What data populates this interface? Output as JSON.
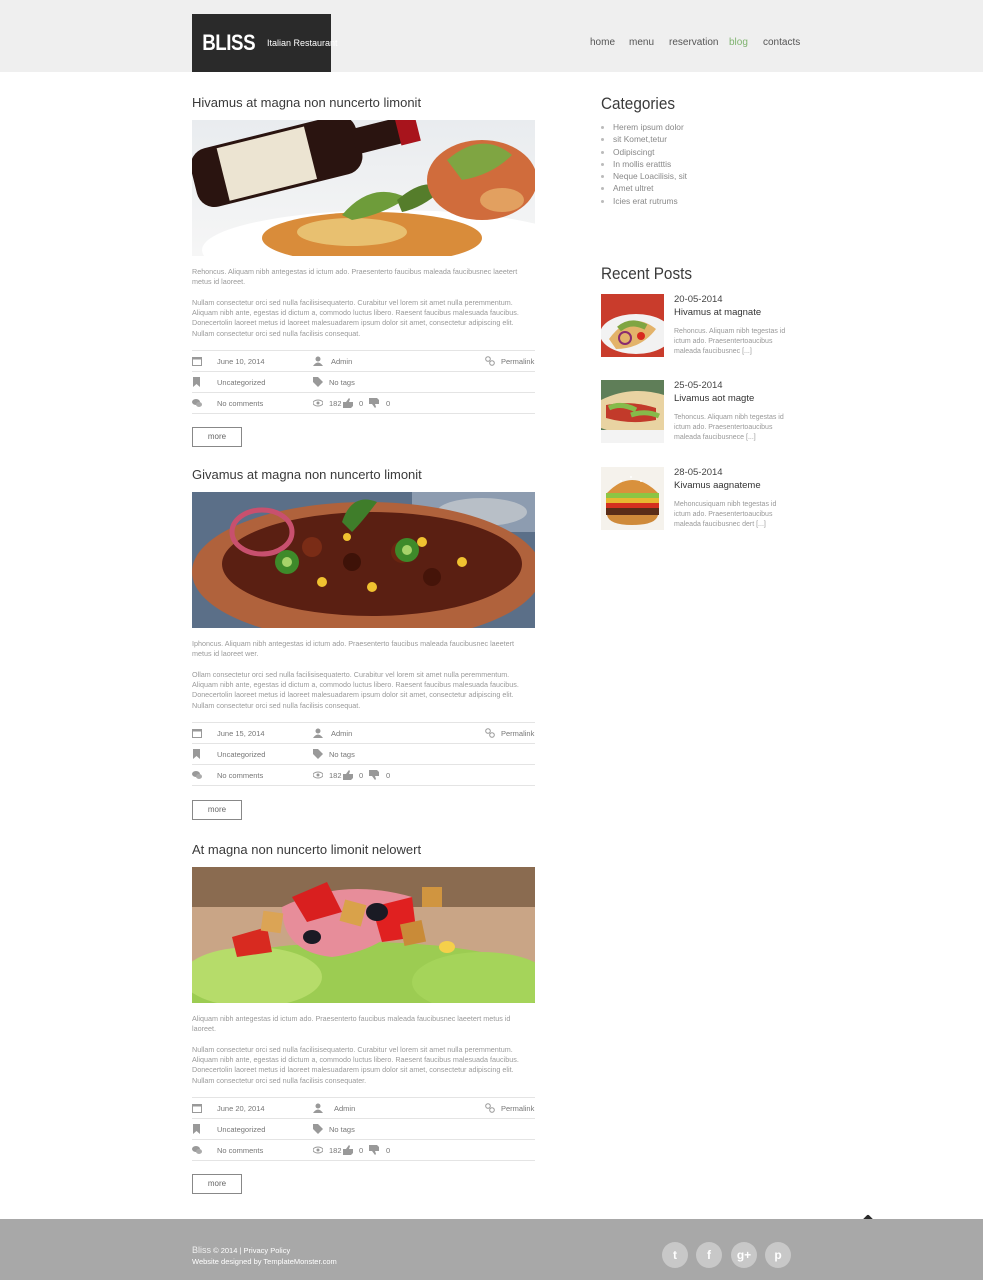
{
  "brand": {
    "name": "BLISS",
    "tagline": "Italian Restaurant"
  },
  "nav": [
    {
      "label": "home",
      "active": false
    },
    {
      "label": "menu",
      "active": false
    },
    {
      "label": "reservation",
      "active": false
    },
    {
      "label": "blog",
      "active": true
    },
    {
      "label": "contacts",
      "active": false
    }
  ],
  "posts": [
    {
      "title": "Hivamus at magna non nuncerto limonit",
      "image": "pasta-with-wine-bottle",
      "excerpt1": "Rehoncus. Aliquam nibh antegestas id ictum ado. Praesenterto faucibus maleada faucibusnec laeetert metus id laoreet.",
      "excerpt2": "Nullam consectetur orci sed nulla facilisisequaterto. Curabitur vel lorem sit amet nulla peremmentum. Aliquam nibh ante, egestas id dictum a, commodo luctus libero. Raesent faucibus malesuada faucibus. Donecertolin laoreet metus id laoreet malesuadarem ipsum dolor sit amet, consectetur adipiscing elit. Nullam consectetur orci sed nulla facilisis consequat.",
      "date": "June  10, 2014",
      "author": "Admin",
      "permalink": "Permalink",
      "category": "Uncategorized",
      "tags": "No tags",
      "comments": "No comments",
      "views": "182",
      "likes": "0",
      "dislikes": "0",
      "more": "more"
    },
    {
      "title": "Givamus at magna non nuncerto limonit",
      "image": "chili-bowl",
      "excerpt1": "Iphoncus. Aliquam nibh antegestas id ictum ado. Praesenterto faucibus maleada faucibusnec laeetert metus id laoreet wer.",
      "excerpt2": "Ollam consectetur orci sed nulla facilisisequaterto. Curabitur vel lorem sit amet nulla peremmentum. Aliquam nibh ante, egestas id dictum a, commodo luctus libero. Raesent faucibus malesuada faucibus. Donecertolin laoreet metus id laoreet malesuadarem ipsum dolor sit amet, consectetur adipiscing elit. Nullam consectetur orci sed nulla facilisis consequat.",
      "date": "June 15, 2014",
      "author": "Admin",
      "permalink": "Permalink",
      "category": "Uncategorized",
      "tags": "No tags",
      "comments": "No comments",
      "views": "182",
      "likes": "0",
      "dislikes": "0",
      "more": "more"
    },
    {
      "title": "At magna non nuncerto limonit nelowert",
      "image": "ham-salad",
      "excerpt1": "Aliquam nibh antegestas id ictum ado. Praesenterto faucibus maleada faucibusnec laeetert metus id laoreet.",
      "excerpt2": "Nullam consectetur orci sed nulla facilisisequaterto. Curabitur vel lorem sit amet nulla peremmentum. Aliquam nibh ante, egestas id dictum a, commodo luctus libero. Raesent faucibus malesuada faucibus. Donecertolin laoreet metus id laoreet malesuadarem ipsum dolor sit amet, consectetur adipiscing elit. Nullam consectetur orci sed nulla facilisis consequater.",
      "date": "June   20, 2014",
      "author": "Admin",
      "permalink": "Permalink",
      "category": "Uncategorized",
      "tags": "No tags",
      "comments": "No comments",
      "views": "182",
      "likes": "0",
      "dislikes": "0",
      "more": "more"
    }
  ],
  "sidebar": {
    "categories_title": "Categories",
    "categories": [
      "Herem ipsum dolor",
      "sit Komet,tetur",
      "Odipiscingt",
      "In mollis eratttis",
      "Neque Loacilisis, sit",
      "Amet ultret",
      "Icies erat rutrums"
    ],
    "recent_title": "Recent Posts",
    "recent": [
      {
        "date": "20-05-2014",
        "title": "Hivamus at magnate",
        "text": "Rehoncus. Aliquam nibh tegestas id ictum ado. Praesentertoaucibus maleada faucibusnec [...]",
        "image": "wrap"
      },
      {
        "date": "25-05-2014",
        "title": "Livamus aot magte",
        "text": "Tehoncus. Aliquam nibh tegestas id ictum ado. Praesentertoaucibus maleada faucibusnece [...]",
        "image": "tortilla"
      },
      {
        "date": "28-05-2014",
        "title": "Kivamus aagnateme",
        "text": "Mehoncusiquam nibh tegestas id ictum ado. Praesentertoaucibus maleada faucibusnec dert [...]",
        "image": "burger"
      }
    ]
  },
  "footer": {
    "brand": "Bliss",
    "copyright": "© 2014 |",
    "privacy": "Privacy Policy",
    "designed": "Website designed by TemplateMonster.com",
    "social": [
      {
        "icon": "twitter-icon",
        "glyph": "t"
      },
      {
        "icon": "facebook-icon",
        "glyph": "f"
      },
      {
        "icon": "google-plus-icon",
        "glyph": "g+"
      },
      {
        "icon": "pinterest-icon",
        "glyph": "p"
      }
    ]
  },
  "colors": {
    "header_bg": "#efefef",
    "footer_bg": "#a8a8a8",
    "accent": "#7fb36f",
    "logo_bg": "#2a2a2a"
  }
}
